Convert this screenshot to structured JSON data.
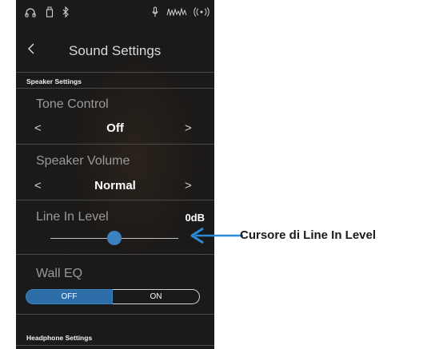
{
  "title_bar": {
    "title": "Sound Settings"
  },
  "sections": {
    "speaker": {
      "header": "Speaker Settings"
    },
    "headphone": {
      "header": "Headphone Settings"
    }
  },
  "tone_control": {
    "label": "Tone Control",
    "value": "Off"
  },
  "speaker_volume": {
    "label": "Speaker Volume",
    "value": "Normal"
  },
  "line_in_level": {
    "label": "Line In Level",
    "value": "0dB",
    "slider_fraction": 0.5
  },
  "wall_eq": {
    "label": "Wall EQ",
    "off_label": "OFF",
    "on_label": "ON",
    "selected": "OFF"
  },
  "annotation": {
    "callout_text": "Cursore di Line In Level"
  },
  "colors": {
    "accent": "#3a82c0",
    "background": "#1a1a1a",
    "callout_arrow": "#2b8ad8"
  },
  "status_icons": [
    "headphones-icon",
    "usb-memory-icon",
    "bluetooth-icon",
    "microphone-icon",
    "sound-wave-icon",
    "wireless-icon"
  ]
}
